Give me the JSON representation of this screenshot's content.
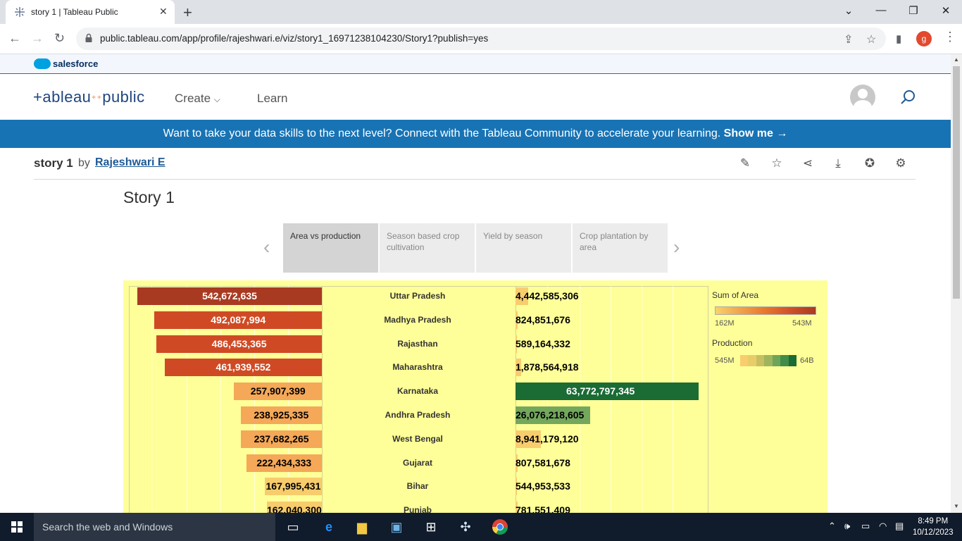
{
  "browser": {
    "tab_title": "story 1 | Tableau Public",
    "url": "public.tableau.com/app/profile/rajeshwari.e/viz/story1_16971238104230/Story1?publish=yes",
    "profile_initial": "g"
  },
  "salesforce": {
    "name": "salesforce"
  },
  "header": {
    "logo": "+ableau",
    "logo_suffix": "public",
    "nav": {
      "create": "Create",
      "learn": "Learn"
    }
  },
  "banner": {
    "text": "Want to take your data skills to the next level? Connect with the Tableau Community to accelerate your learning.",
    "cta": "Show me →"
  },
  "viz_header": {
    "title": "story 1",
    "by": "by",
    "author": "Rajeshwari E"
  },
  "story": {
    "title": "Story 1",
    "points": [
      "Area vs production",
      "Season based crop cultivation",
      "Yield by season",
      "Crop plantation by area"
    ],
    "active_point": 0
  },
  "legend": {
    "area_title": "Sum of Area",
    "area_min": "162M",
    "area_max": "543M",
    "prod_title": "Production",
    "prod_min": "545M",
    "prod_max": "64B"
  },
  "colors": {
    "area_high": "#a93a22",
    "area_mid": "#cf4a24",
    "area_low": "#f4a858",
    "area_lowest": "#f7cc6c",
    "prod_high": "#1a6b34",
    "prod_mid": "#73a85c",
    "prod_low": "#f8cd6e"
  },
  "chart_data": {
    "type": "bar",
    "categories": [
      "Uttar Pradesh",
      "Madhya Pradesh",
      "Rajasthan",
      "Maharashtra",
      "Karnataka",
      "Andhra Pradesh",
      "West Bengal",
      "Gujarat",
      "Bihar",
      "Punjab"
    ],
    "series": [
      {
        "name": "Sum of Area",
        "values": [
          542672635,
          492087994,
          486453365,
          461939552,
          257907399,
          238925335,
          237682265,
          222434333,
          167995431,
          162040300
        ]
      },
      {
        "name": "Production",
        "values": [
          4442585306,
          824851676,
          589164332,
          1878564918,
          63772797345,
          26076218605,
          8941179120,
          807581678,
          544953533,
          781551409
        ]
      }
    ],
    "labels_area": [
      "542,672,635",
      "492,087,994",
      "486,453,365",
      "461,939,552",
      "257,907,399",
      "238,925,335",
      "237,682,265",
      "222,434,333",
      "167,995,431",
      "162,040,300"
    ],
    "labels_prod": [
      "4,442,585,306",
      "824,851,676",
      "589,164,332",
      "1,878,564,918",
      "63,772,797,345",
      "26,076,218,605",
      "8,941,179,120",
      "807,581,678",
      "544,953,533",
      "781,551,409"
    ]
  },
  "taskbar": {
    "search_placeholder": "Search the web and Windows",
    "time": "8:49 PM",
    "date": "10/12/2023"
  }
}
